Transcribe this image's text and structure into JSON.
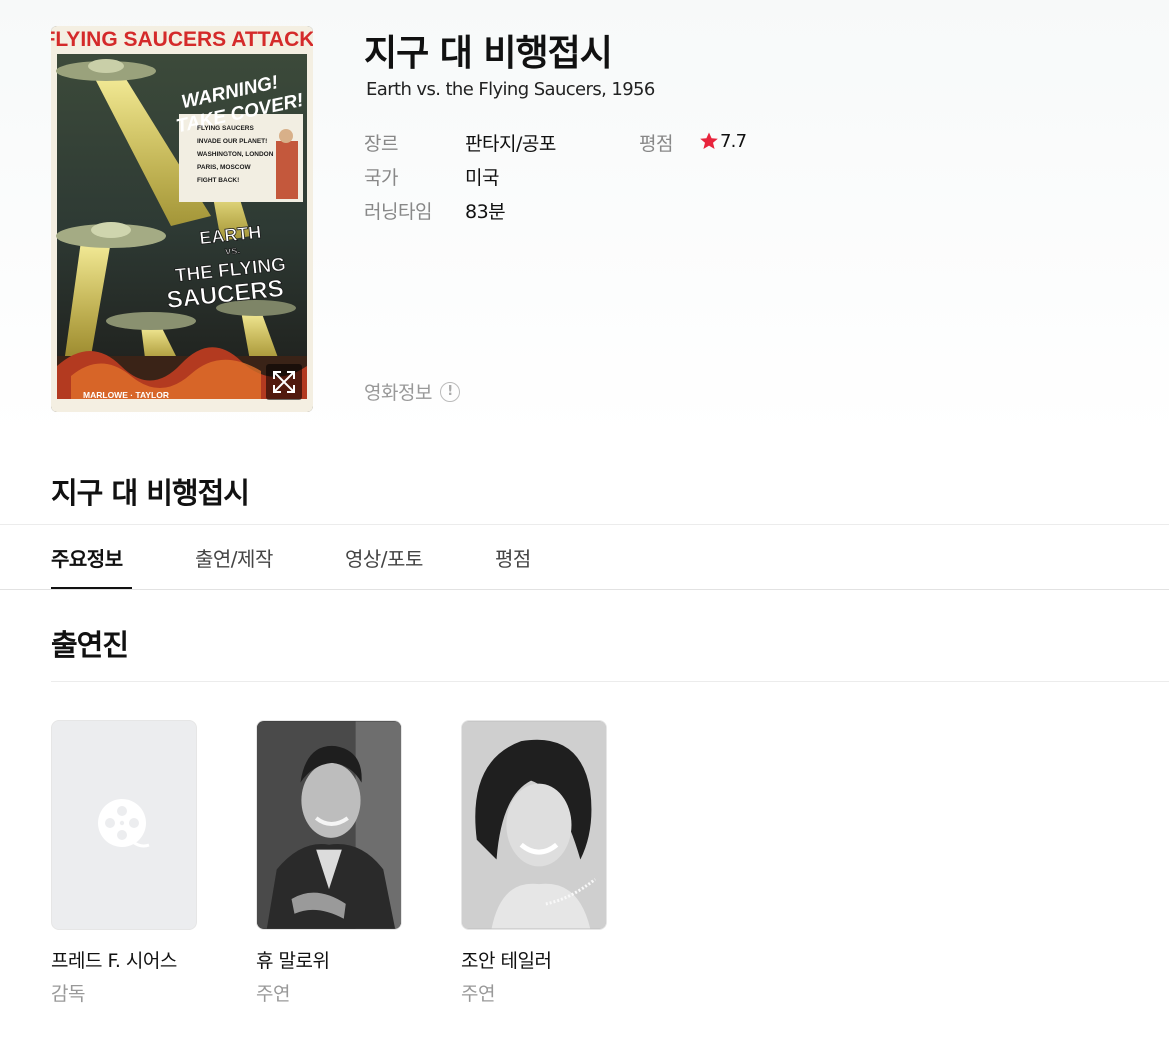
{
  "movie": {
    "title": "지구 대 비행접시",
    "subtitle": "Earth vs. the Flying Saucers, 1956",
    "poster_text": {
      "top_banner": "FLYING SAUCERS ATTACK!",
      "warning_1": "WARNING!",
      "warning_2": "TAKE COVER!",
      "card_lines": [
        "FLYING SAUCERS",
        "INVADE OUR PLANET!",
        "WASHINGTON, LONDON",
        "PARIS, MOSCOW",
        "FIGHT BACK!"
      ],
      "main_title_1": "EARTH",
      "main_title_2": "vs.",
      "main_title_3": "THE FLYING",
      "main_title_4": "SAUCERS",
      "credits": "MARLOWE · TAYLOR"
    },
    "info": {
      "genre_label": "장르",
      "genre_value": "판타지/공포",
      "country_label": "국가",
      "country_value": "미국",
      "runtime_label": "러닝타임",
      "runtime_value": "83분",
      "rating_label": "평점",
      "rating_value": "7.7"
    },
    "movie_info_link": "영화정보",
    "info_icon_glyph": "!"
  },
  "section_title": "지구 대 비행접시",
  "tabs": [
    {
      "label": "주요정보",
      "active": true
    },
    {
      "label": "출연/제작",
      "active": false
    },
    {
      "label": "영상/포토",
      "active": false
    },
    {
      "label": "평점",
      "active": false
    }
  ],
  "cast": {
    "heading": "출연진",
    "members": [
      {
        "name": "프레드 F. 시어스",
        "role": "감독",
        "photo": "film-reel-placeholder-icon"
      },
      {
        "name": "휴 말로위",
        "role": "주연",
        "photo": "actor-photo-grayscale"
      },
      {
        "name": "조안 테일러",
        "role": "주연",
        "photo": "actress-photo-grayscale"
      }
    ]
  },
  "colors": {
    "star": "#e8243c",
    "label_gray": "#888888",
    "text": "#111111",
    "placeholder_bg": "#ecedef"
  }
}
